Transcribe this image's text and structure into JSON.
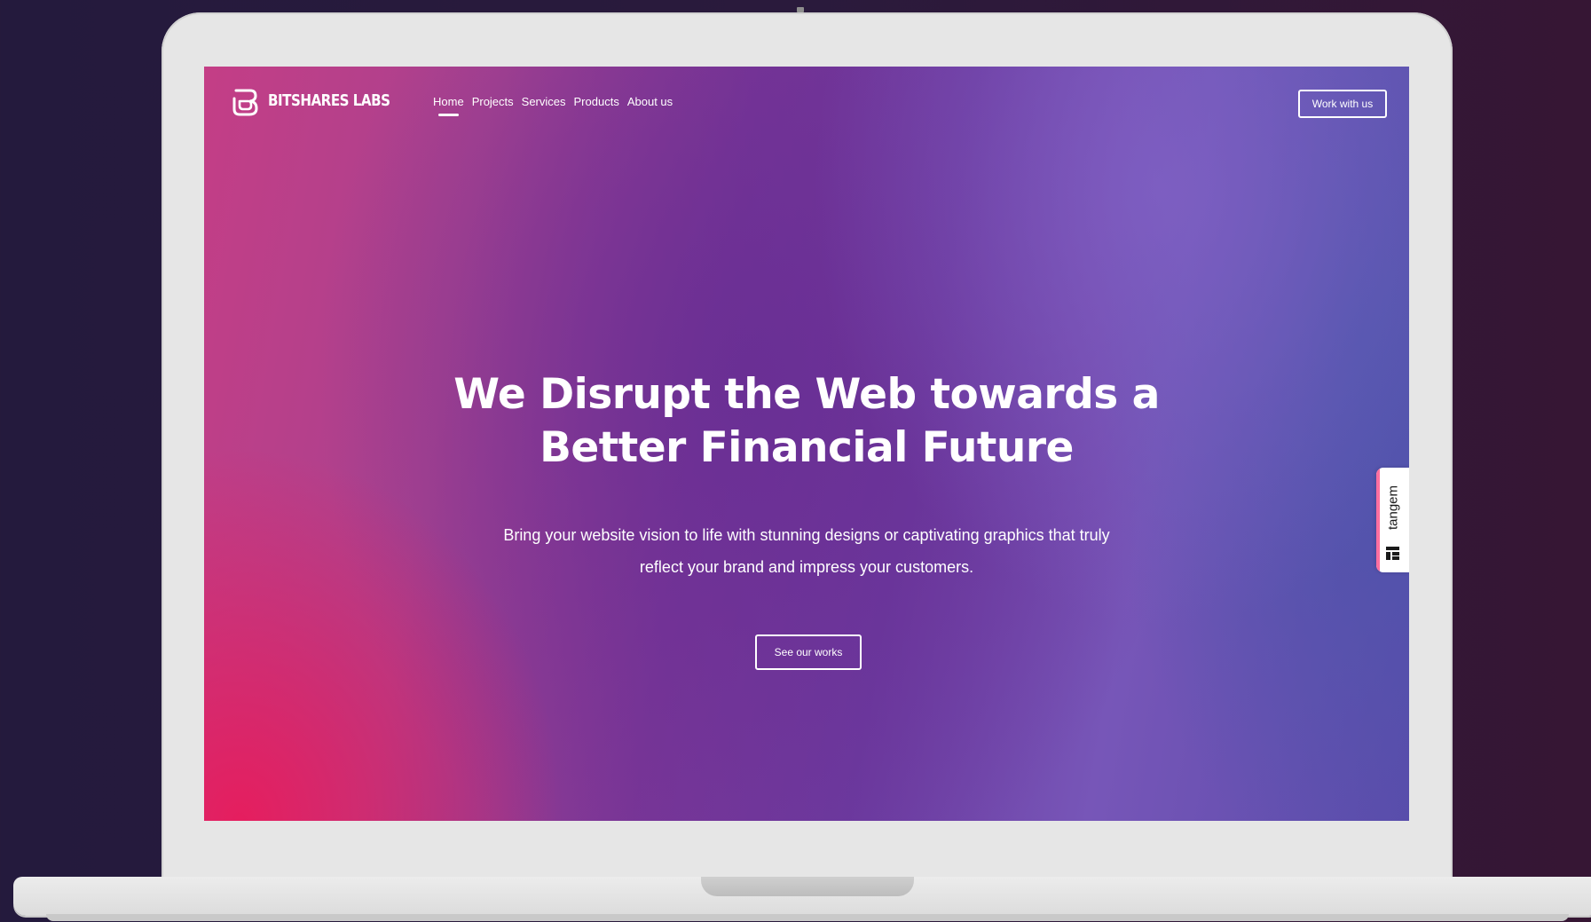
{
  "nav": {
    "brand": "BITSHARES LABS",
    "links": [
      "Home",
      "Projects",
      "Services",
      "Products",
      "About us"
    ],
    "active_link": "Home",
    "cta": "Work with us"
  },
  "hero": {
    "title_line1": "We Disrupt the Web towards a",
    "title_line2": "Better Financial Future",
    "subtitle_line1": "Bring your website vision to life with stunning designs or captivating graphics that truly",
    "subtitle_line2": "reflect your brand and impress your customers.",
    "cta": "See our works"
  },
  "widget": {
    "label": "tangem"
  },
  "colors": {
    "background": "#2a1a3c",
    "laptop": "#e6e6e6",
    "gradient_pink": "#e81c5c",
    "gradient_purple": "#6c3a9f",
    "gradient_blue": "#4856aa",
    "text": "#ffffff"
  }
}
